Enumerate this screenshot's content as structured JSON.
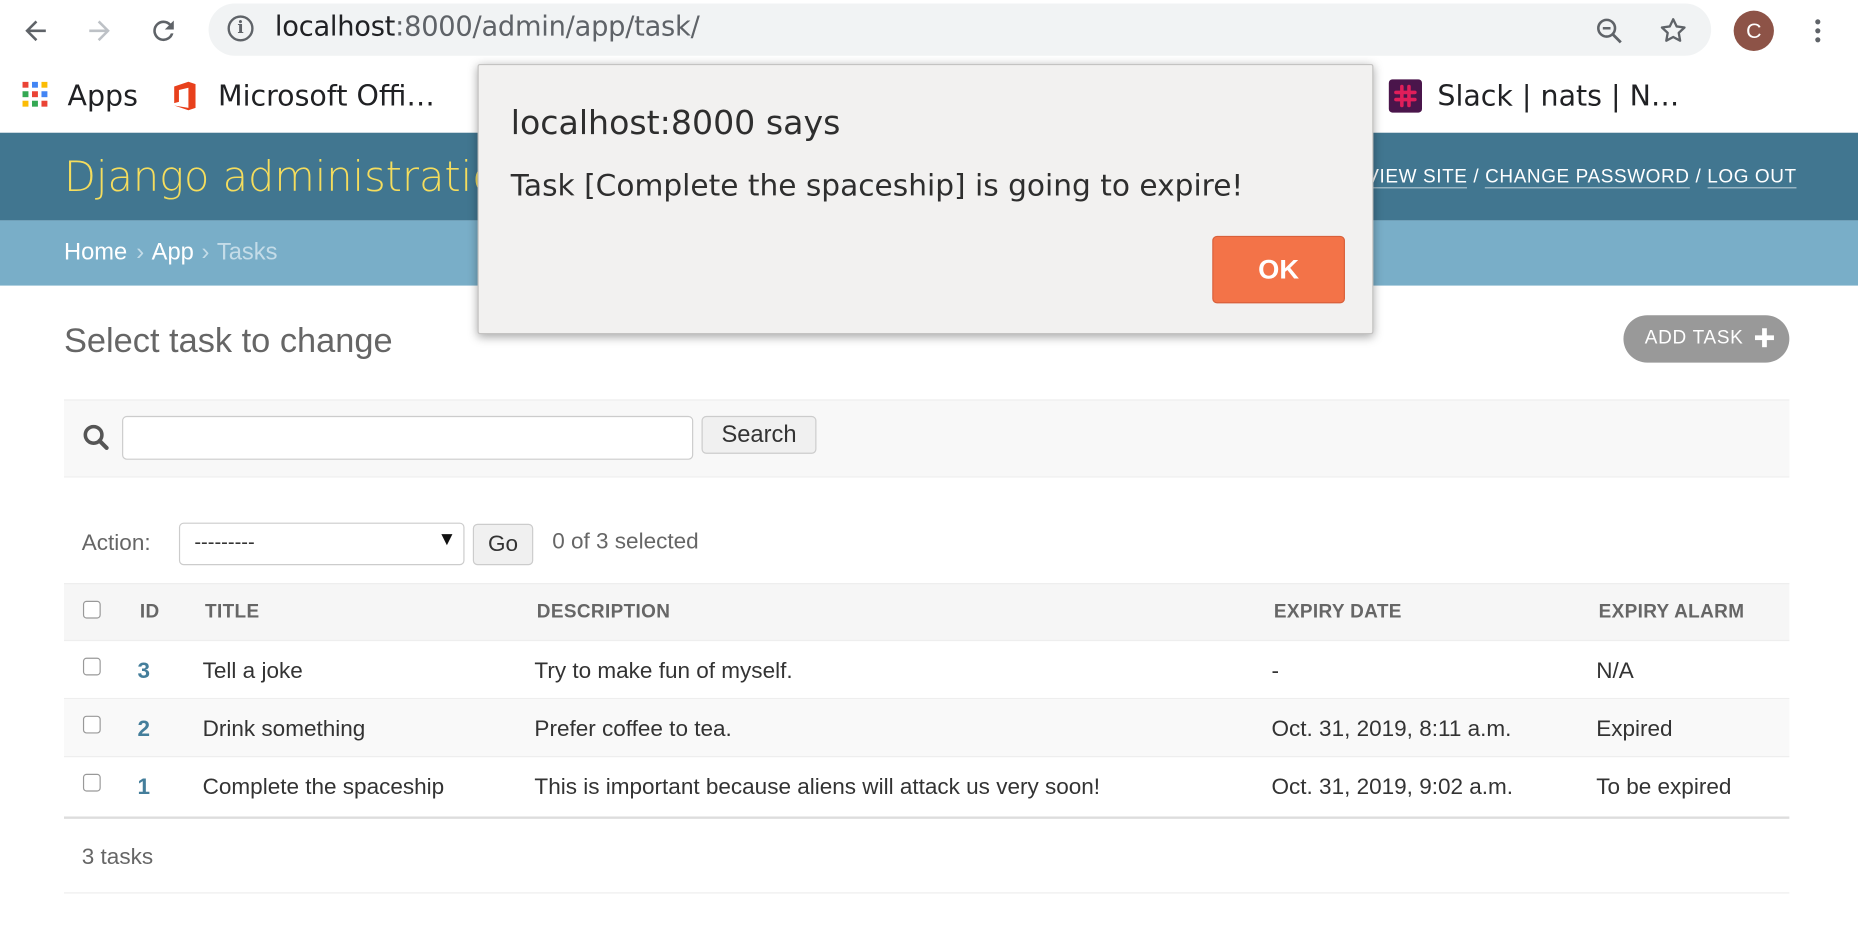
{
  "browser": {
    "url_host": "localhost",
    "url_rest": ":8000/admin/app/task/",
    "avatar_letter": "C",
    "bookmarks": [
      {
        "label": "Apps",
        "icon": "apps-grid-icon"
      },
      {
        "label": "Microsoft Offi…",
        "icon": "office-icon"
      },
      {
        "label": "Slack | nats | N…",
        "icon": "slack-icon"
      }
    ]
  },
  "header": {
    "branding": "Django administration",
    "user_tools": {
      "view_site": "View site",
      "sep1": "/",
      "change_password": "Change password",
      "sep2": "/",
      "log_out": "Log out"
    }
  },
  "breadcrumbs": {
    "home": "Home",
    "sep": "›",
    "app": "App",
    "current": "Tasks"
  },
  "content": {
    "title": "Select task to change",
    "add_button": "Add task",
    "search_button": "Search",
    "search_value": "",
    "action_label": "Action:",
    "action_selected": "---------",
    "go_button": "Go",
    "selection_counter": "0 of 3 selected",
    "columns": [
      "ID",
      "Title",
      "Description",
      "Expiry date",
      "Expiry alarm"
    ],
    "rows": [
      {
        "id": "3",
        "title": "Tell a joke",
        "description": "Try to make fun of myself.",
        "expiry_date": "-",
        "expiry_alarm": "N/A"
      },
      {
        "id": "2",
        "title": "Drink something",
        "description": "Prefer coffee to tea.",
        "expiry_date": "Oct. 31, 2019, 8:11 a.m.",
        "expiry_alarm": "Expired"
      },
      {
        "id": "1",
        "title": "Complete the spaceship",
        "description": "This is important because aliens will attack us very soon!",
        "expiry_date": "Oct. 31, 2019, 9:02 a.m.",
        "expiry_alarm": "To be expired"
      }
    ],
    "paginator": "3 tasks"
  },
  "dialog": {
    "title": "localhost:8000 says",
    "message": "Task [Complete the spaceship] is going to expire!",
    "ok_button": "OK"
  },
  "colors": {
    "header": "#417690",
    "breadcrumbs": "#79aec8",
    "branding": "#f5dd5d",
    "link": "#447e9b",
    "ok_button": "#f37348"
  }
}
